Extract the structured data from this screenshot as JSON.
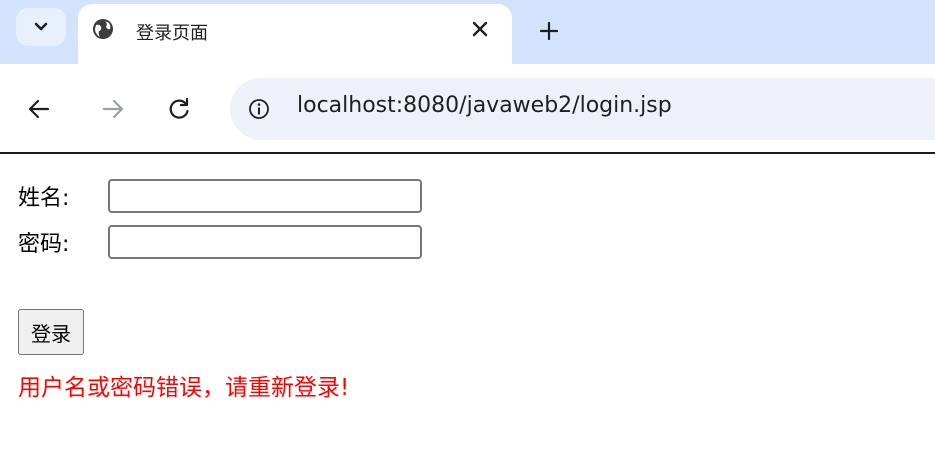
{
  "tab": {
    "title": "登录页面",
    "favicon": "globe-icon",
    "close": "close-icon",
    "new_tab": "plus-icon"
  },
  "toolbar": {
    "back": "back-arrow-icon",
    "forward": "forward-arrow-icon",
    "reload": "reload-icon",
    "site_info": "info-icon",
    "url_host": "localhost",
    "url_rest": ":8080/javaweb2/login.jsp"
  },
  "form": {
    "name_label": "姓名:",
    "password_label": "密码:",
    "name_value": "",
    "password_value": "",
    "submit_label": "登录"
  },
  "message": {
    "error": "用户名或密码错误，请重新登录!",
    "color": "#ff0000"
  },
  "colors": {
    "tabstrip": "#d3e3fd",
    "omnibox": "#edf2fa"
  }
}
